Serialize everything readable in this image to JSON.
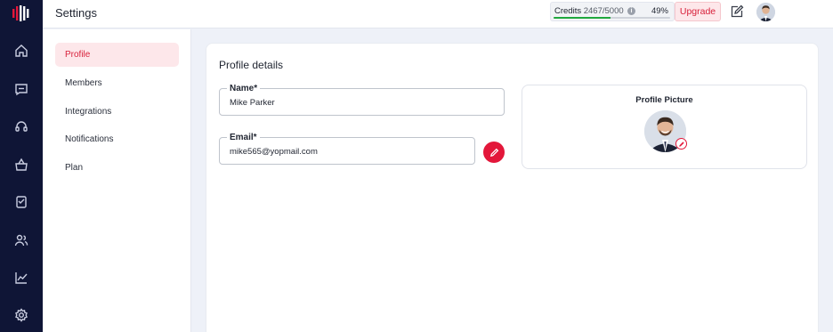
{
  "app": {
    "brand_color": "#0f1536",
    "accent_color": "#e3173a"
  },
  "rail": {
    "icons": [
      "home-icon",
      "chat-icon",
      "headset-icon",
      "basket-icon",
      "tasks-icon",
      "users-icon",
      "analytics-icon",
      "settings-icon"
    ]
  },
  "header": {
    "title": "Settings",
    "credits": {
      "label": "Credits",
      "value": "2467/5000",
      "percent_label": "49%",
      "percent": 49
    },
    "upgrade_label": "Upgrade"
  },
  "sidebar": {
    "items": [
      {
        "label": "Profile",
        "active": true
      },
      {
        "label": "Members",
        "active": false
      },
      {
        "label": "Integrations",
        "active": false
      },
      {
        "label": "Notifications",
        "active": false
      },
      {
        "label": "Plan",
        "active": false
      }
    ]
  },
  "main": {
    "section_title": "Profile details",
    "name_field": {
      "label": "Name*",
      "value": "Mike Parker"
    },
    "email_field": {
      "label": "Email*",
      "value": "mike565@yopmail.com"
    },
    "profile_picture": {
      "title": "Profile Picture"
    }
  }
}
